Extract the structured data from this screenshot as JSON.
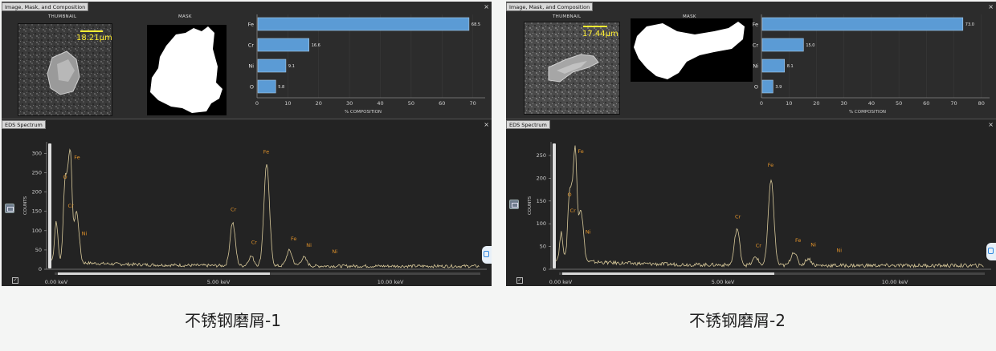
{
  "panels": [
    {
      "window_title": "Image, Mask, and Composition",
      "thumbnail_label": "THUMBNAIL",
      "mask_label": "MASK",
      "scale_text": "18.21μm",
      "composition": {
        "xlabel": "% COMPOSITION",
        "xticks": [
          0,
          10,
          20,
          30,
          40,
          50,
          60,
          70
        ],
        "xmax": 74,
        "elements": [
          "Fe",
          "Cr",
          "Ni",
          "O"
        ],
        "values": [
          68.5,
          16.6,
          9.1,
          5.8
        ],
        "value_labels": [
          "68.5",
          "16.6",
          "9.1",
          "5.8"
        ],
        "bar_color": "#5b9bd5"
      },
      "spectrum": {
        "title": "EDS Spectrum",
        "ylabel": "COUNTS",
        "yticks": [
          0,
          50,
          100,
          150,
          200,
          250,
          300
        ],
        "ymax": 330,
        "xtick_labels": [
          "0.00 keV",
          "5.00 keV",
          "10.00 keV"
        ],
        "xtick_values": [
          0,
          5,
          10
        ],
        "xmax": 12.8,
        "line_color": "#d8c99a",
        "label_color": "#e0922a",
        "peaks": [
          {
            "kev": 0.28,
            "counts": 105
          },
          {
            "kev": 0.53,
            "counts": 185
          },
          {
            "kev": 0.62,
            "counts": 150
          },
          {
            "kev": 0.7,
            "counts": 240
          },
          {
            "kev": 0.85,
            "counts": 110
          },
          {
            "kev": 0.93,
            "counts": 60
          },
          {
            "kev": 5.41,
            "counts": 112
          },
          {
            "kev": 5.95,
            "counts": 25
          },
          {
            "kev": 6.4,
            "counts": 265
          },
          {
            "kev": 7.06,
            "counts": 40
          },
          {
            "kev": 7.48,
            "counts": 22
          }
        ],
        "annotations": [
          {
            "text": "Fe",
            "kev": 0.8,
            "counts": 285
          },
          {
            "text": "O",
            "kev": 0.48,
            "counts": 235
          },
          {
            "text": "Cr",
            "kev": 0.62,
            "counts": 160
          },
          {
            "text": "Ni",
            "kev": 1.02,
            "counts": 88
          },
          {
            "text": "Cr",
            "kev": 5.35,
            "counts": 150
          },
          {
            "text": "Cr",
            "kev": 5.95,
            "counts": 65
          },
          {
            "text": "Fe",
            "kev": 6.3,
            "counts": 300
          },
          {
            "text": "Fe",
            "kev": 7.1,
            "counts": 75
          },
          {
            "text": "Ni",
            "kev": 7.55,
            "counts": 58
          },
          {
            "text": "Ni",
            "kev": 8.3,
            "counts": 42
          }
        ]
      },
      "caption": "不锈钢磨屑-1"
    },
    {
      "window_title": "Image, Mask, and Composition",
      "thumbnail_label": "THUMBNAIL",
      "mask_label": "MASK",
      "scale_text": "17.44μm",
      "composition": {
        "xlabel": "% COMPOSITION",
        "xticks": [
          0,
          10,
          20,
          30,
          40,
          50,
          60,
          70,
          80
        ],
        "xmax": 83,
        "elements": [
          "Fe",
          "Cr",
          "Ni",
          "O"
        ],
        "values": [
          73.0,
          15.0,
          8.1,
          3.9
        ],
        "value_labels": [
          "73.0",
          "15.0",
          "8.1",
          "3.9"
        ],
        "bar_color": "#5b9bd5"
      },
      "spectrum": {
        "title": "EDS Spectrum",
        "ylabel": "COUNTS",
        "yticks": [
          0,
          50,
          100,
          150,
          200,
          250
        ],
        "ymax": 280,
        "xtick_labels": [
          "0.00 keV",
          "5.00 keV",
          "10.00 keV"
        ],
        "xtick_values": [
          0,
          5,
          10
        ],
        "xmax": 12.8,
        "line_color": "#d8c99a",
        "label_color": "#e0922a",
        "peaks": [
          {
            "kev": 0.3,
            "counts": 60
          },
          {
            "kev": 0.53,
            "counts": 130
          },
          {
            "kev": 0.62,
            "counts": 110
          },
          {
            "kev": 0.71,
            "counts": 225
          },
          {
            "kev": 0.85,
            "counts": 95
          },
          {
            "kev": 0.93,
            "counts": 50
          },
          {
            "kev": 5.41,
            "counts": 80
          },
          {
            "kev": 5.95,
            "counts": 18
          },
          {
            "kev": 6.4,
            "counts": 190
          },
          {
            "kev": 7.06,
            "counts": 30
          },
          {
            "kev": 7.48,
            "counts": 15
          }
        ],
        "annotations": [
          {
            "text": "Fe",
            "kev": 0.78,
            "counts": 255
          },
          {
            "text": "O",
            "kev": 0.48,
            "counts": 160
          },
          {
            "text": "Cr",
            "kev": 0.55,
            "counts": 125
          },
          {
            "text": "Ni",
            "kev": 1.0,
            "counts": 78
          },
          {
            "text": "Cr",
            "kev": 5.35,
            "counts": 112
          },
          {
            "text": "Cr",
            "kev": 5.95,
            "counts": 48
          },
          {
            "text": "Fe",
            "kev": 6.3,
            "counts": 225
          },
          {
            "text": "Fe",
            "kev": 7.1,
            "counts": 60
          },
          {
            "text": "Ni",
            "kev": 7.55,
            "counts": 50
          },
          {
            "text": "Ni",
            "kev": 8.3,
            "counts": 38
          }
        ]
      },
      "caption": "不锈钢磨屑-2"
    }
  ]
}
